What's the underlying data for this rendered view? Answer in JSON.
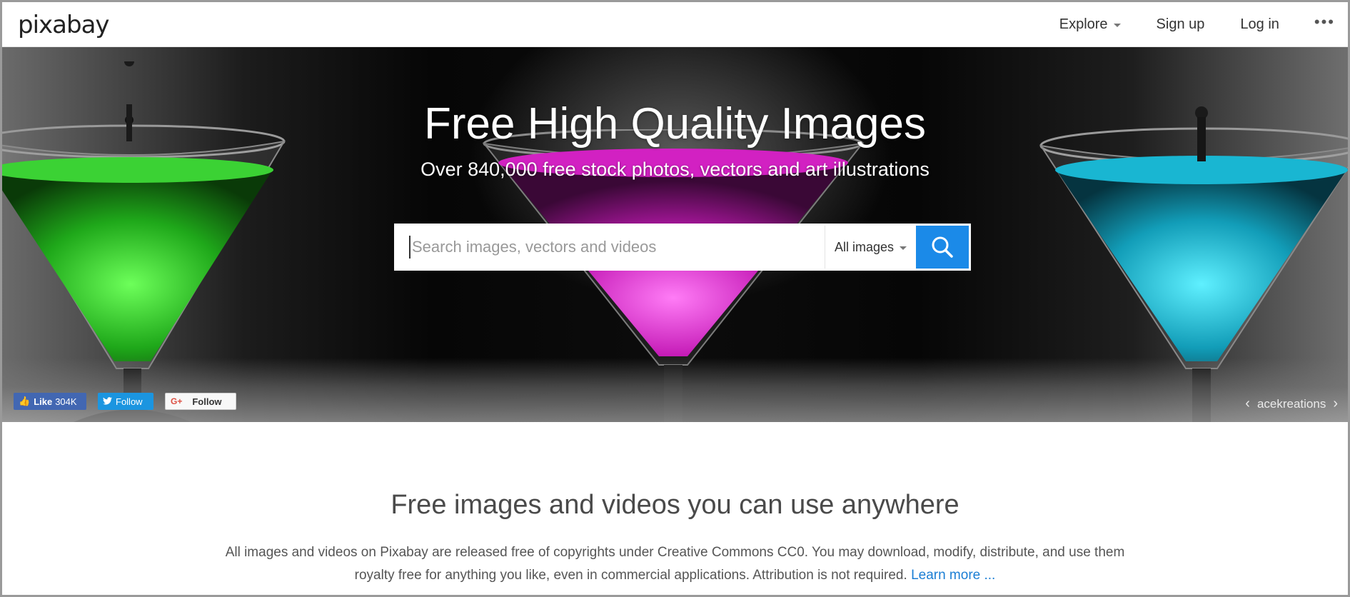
{
  "header": {
    "logo": "pixabay",
    "nav": {
      "explore": "Explore",
      "signup": "Sign up",
      "login": "Log in",
      "more": "•••"
    }
  },
  "hero": {
    "title": "Free High Quality Images",
    "subtitle": "Over 840,000 free stock photos, vectors and art illustrations",
    "search": {
      "placeholder": "Search images, vectors and videos",
      "value": "",
      "type_selected": "All images"
    },
    "social": {
      "facebook_label": "Like",
      "facebook_count": "304K",
      "twitter_label": "Follow",
      "google_label": "Follow",
      "google_icon": "G+"
    },
    "credit": {
      "prev": "‹",
      "author": "acekreations",
      "next": "›"
    }
  },
  "content": {
    "heading": "Free images and videos you can use anywhere",
    "text": "All images and videos on Pixabay are released free of copyrights under Creative Commons CC0. You may download, modify, distribute, and use them royalty free for anything you like, even in commercial applications. Attribution is not required.",
    "learn_more": "Learn more ..."
  },
  "colors": {
    "accent": "#1b8ae8",
    "link": "#1b7ed4",
    "glass_green": "#2fd12a",
    "glass_magenta": "#d81fc8",
    "glass_cyan": "#17b7d6"
  },
  "icons": {
    "search": "magnifier-icon",
    "explore_caret": "chevron-down-icon",
    "facebook": "thumbs-up-icon",
    "twitter": "twitter-bird-icon",
    "google": "google-plus-icon"
  }
}
